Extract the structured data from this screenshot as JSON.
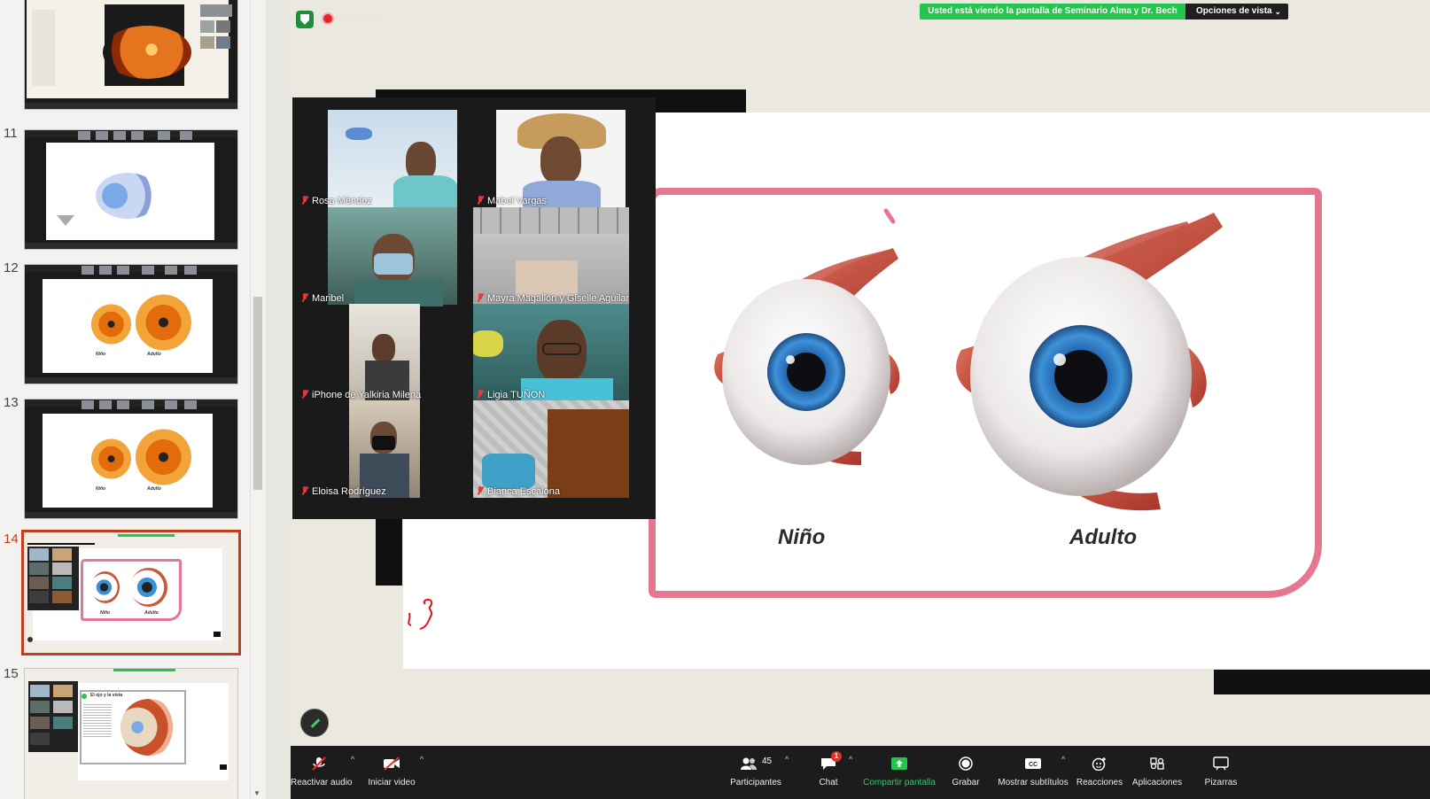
{
  "thumbnails": [
    {
      "number": "",
      "kind": "retina"
    },
    {
      "number": "11",
      "kind": "diagram"
    },
    {
      "number": "12",
      "kind": "eyes-section"
    },
    {
      "number": "13",
      "kind": "eyes-section"
    },
    {
      "number": "14",
      "kind": "eyes-round",
      "active": true
    },
    {
      "number": "15",
      "kind": "eye-text"
    }
  ],
  "thumbnail_texts": {
    "nino": "Niño",
    "adulto": "Adulto",
    "eye_title": "El ojo y la vista"
  },
  "meeting": {
    "recording_label": "Grabando",
    "viewing_banner": "Usted está viendo la pantalla de Seminario Alma y Dr. Bech",
    "view_options": "Opciones de vista"
  },
  "slide": {
    "label_left": "Niño",
    "label_right": "Adulto",
    "accent_color": "#e57791"
  },
  "participants": [
    {
      "name": "Rosa Méndez"
    },
    {
      "name": "Mabel Vargas"
    },
    {
      "name": "Maribel"
    },
    {
      "name": "Mayra Magallón y Giselle Aguilar"
    },
    {
      "name": "iPhone de Yalkiria Milena"
    },
    {
      "name": "Ligia TUÑON"
    },
    {
      "name": "Eloisa Rodríguez"
    },
    {
      "name": "Bianca Escalona"
    }
  ],
  "toolbar": {
    "unmute": "Reactivar audio",
    "start_video": "Iniciar video",
    "participants": "Participantes",
    "participants_count": "45",
    "chat": "Chat",
    "chat_badge": "1",
    "share": "Compartir pantalla",
    "record": "Grabar",
    "captions": "Mostrar subtítulos",
    "reactions": "Reacciones",
    "apps": "Aplicaciones",
    "whiteboards": "Pizarras"
  }
}
